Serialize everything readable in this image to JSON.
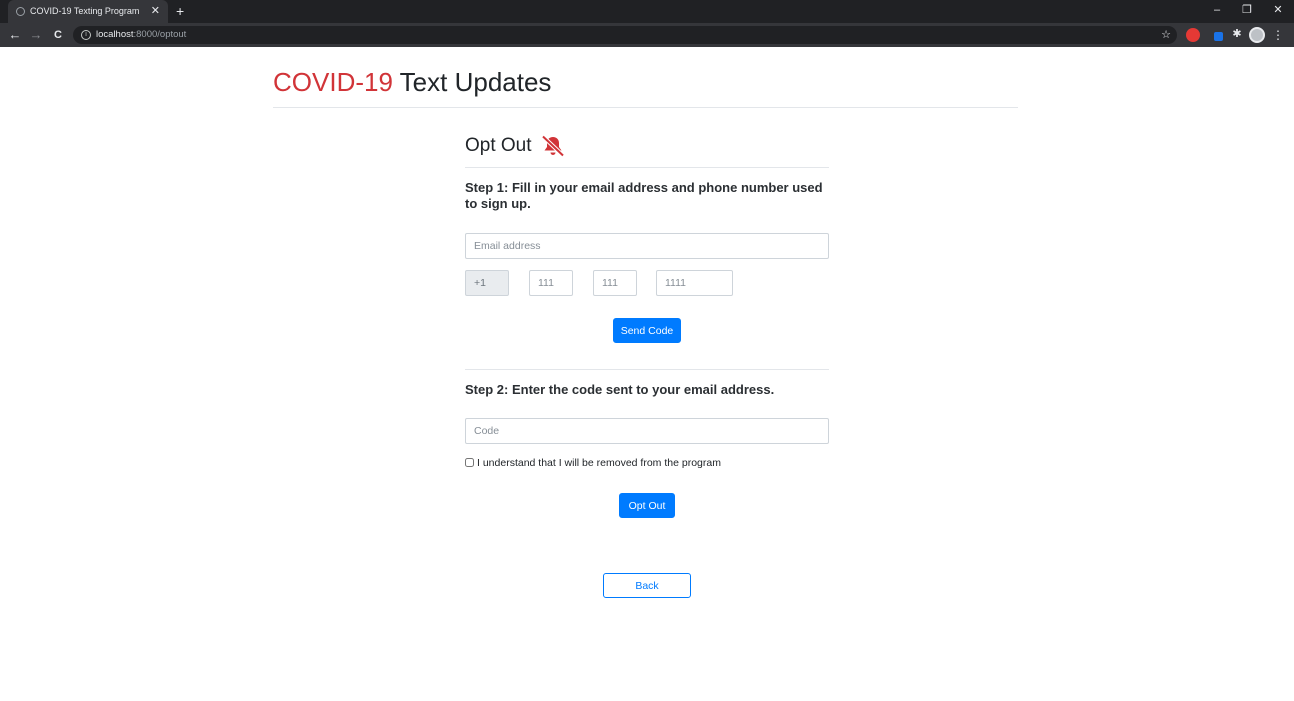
{
  "browser": {
    "tab_title": "COVID-19 Texting Program",
    "tab_close": "✕",
    "new_tab": "+",
    "window_controls": {
      "minimize": "–",
      "restore": "❐",
      "close": "✕"
    },
    "nav": {
      "back": "←",
      "forward": "→",
      "reload": "C"
    },
    "url_host": "localhost",
    "url_path": ":8000/optout",
    "star": "☆",
    "puzzle": "✱",
    "menu": "⋮"
  },
  "header": {
    "title_accent": "COVID-19",
    "title_rest": " Text Updates",
    "accent_color": "#d13438"
  },
  "optout": {
    "heading": "Opt Out",
    "heading_icon": "bell-slash-icon",
    "step1": "Step 1: Fill in your email address and phone number used to sign up.",
    "email_placeholder": "Email address",
    "country_code": "+1",
    "phone_area_placeholder": "111",
    "phone_prefix_placeholder": "111",
    "phone_line_placeholder": "1111",
    "send_code_label": "Send Code",
    "step2": "Step 2: Enter the code sent to your email address.",
    "code_placeholder": "Code",
    "confirm_label": "I understand that I will be removed from the program",
    "opt_out_label": "Opt Out",
    "back_label": "Back",
    "button_color": "#007bff"
  }
}
